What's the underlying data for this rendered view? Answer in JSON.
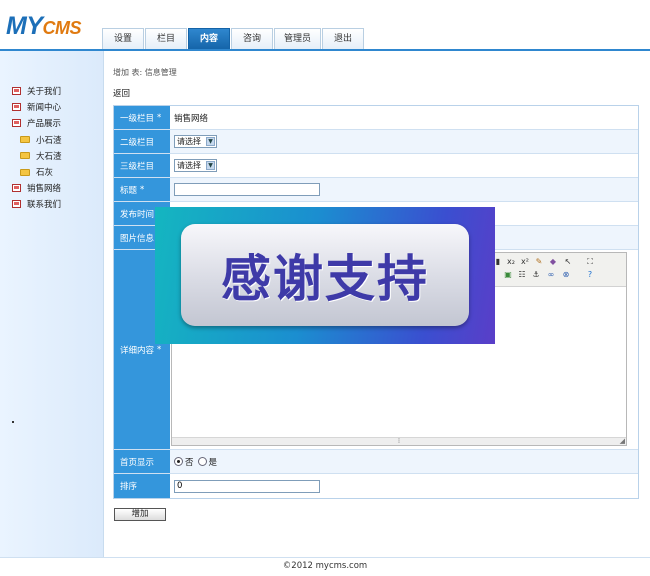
{
  "logo": {
    "my": "MY",
    "cms": "CMS"
  },
  "tabs": [
    {
      "label": "设置"
    },
    {
      "label": "栏目"
    },
    {
      "label": "内容",
      "active": true
    },
    {
      "label": "咨询"
    },
    {
      "label": "管理员"
    },
    {
      "label": "退出"
    }
  ],
  "sidebar": {
    "items": [
      {
        "label": "关于我们",
        "icon": "document-icon"
      },
      {
        "label": "新闻中心",
        "icon": "document-icon"
      },
      {
        "label": "产品展示",
        "icon": "document-icon"
      },
      {
        "label": "小石渣",
        "icon": "folder-icon"
      },
      {
        "label": "大石渣",
        "icon": "folder-icon"
      },
      {
        "label": "石灰",
        "icon": "folder-icon"
      },
      {
        "label": "销售网络",
        "icon": "document-icon"
      },
      {
        "label": "联系我们",
        "icon": "document-icon"
      }
    ]
  },
  "breadcrumb": "增加 表: 信息管理",
  "back_label": "返回",
  "form": {
    "level1": {
      "label": "一级栏目",
      "required": "*",
      "value": "销售网络"
    },
    "level2": {
      "label": "二级栏目",
      "select": "请选择"
    },
    "level3": {
      "label": "三级栏目",
      "select": "请选择"
    },
    "title": {
      "label": "标题",
      "required": "*",
      "value": ""
    },
    "publish_time": {
      "label": "发布时间"
    },
    "image_info": {
      "label": "图片信息"
    },
    "detail": {
      "label": "详细内容",
      "required": "*"
    },
    "homepage": {
      "label": "首页显示",
      "no": "否",
      "yes": "是",
      "selected": "否"
    },
    "sort": {
      "label": "排序",
      "value": "0"
    }
  },
  "submit_label": "增加",
  "footer": "©2012 mycms.com",
  "overlay_text": "感谢支持",
  "colors": {
    "accent": "#3496dc",
    "brand_blue": "#1c6fb8",
    "brand_orange": "#e07a10"
  }
}
